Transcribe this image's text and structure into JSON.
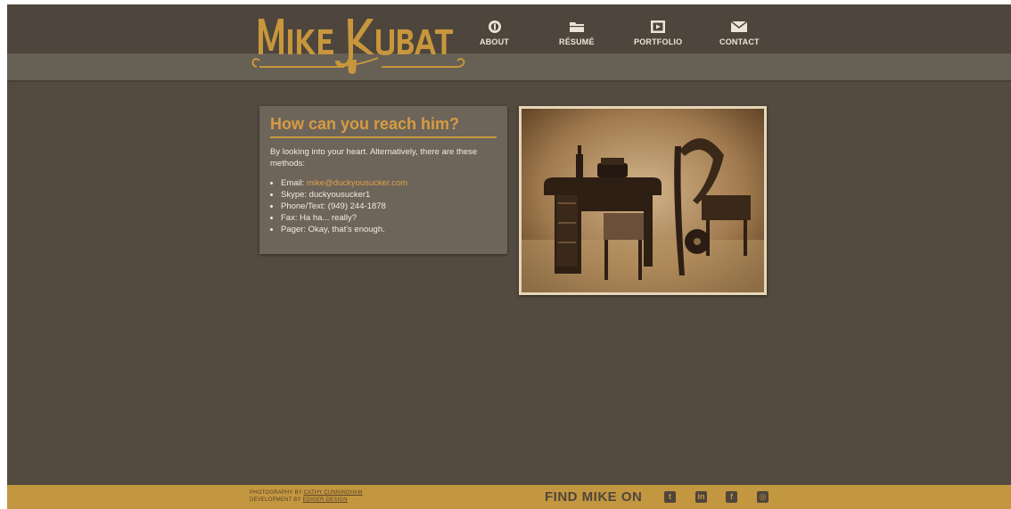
{
  "site": {
    "logo_text": "MIKE KUBAT"
  },
  "nav": {
    "items": [
      {
        "label": "ABOUT",
        "icon": "coin-icon"
      },
      {
        "label": "RÉSUMÉ",
        "icon": "folder-icon"
      },
      {
        "label": "PORTFOLIO",
        "icon": "film-icon"
      },
      {
        "label": "CONTACT",
        "icon": "envelope-icon"
      }
    ]
  },
  "contact": {
    "heading": "How can you reach him?",
    "intro": "By looking into your heart. Alternatively, there are these methods:",
    "email_label": "Email: ",
    "email": "mike@duckyousucker.com",
    "skype": "Skype: duckyousucker1",
    "phone": "Phone/Text: (949) 244-1878",
    "fax": "Fax: Ha ha... really?",
    "pager": "Pager: Okay, that's enough."
  },
  "footer": {
    "photo_prefix": "PHOTOGRAPHY BY ",
    "photo_credit": "CATHY CUNNINGHAM",
    "dev_prefix": "DEVELOPMENT BY ",
    "dev_credit": "EDIGER DESIGN",
    "find_text": "FIND MIKE ON",
    "social": [
      {
        "name": "twitter",
        "glyph": "t"
      },
      {
        "name": "linkedin",
        "glyph": "in"
      },
      {
        "name": "facebook",
        "glyph": "f"
      },
      {
        "name": "instagram",
        "glyph": "◎"
      }
    ]
  },
  "colors": {
    "background": "#534a40",
    "accent": "#c39640",
    "heading": "#d79c42",
    "card": "#6d645a"
  }
}
